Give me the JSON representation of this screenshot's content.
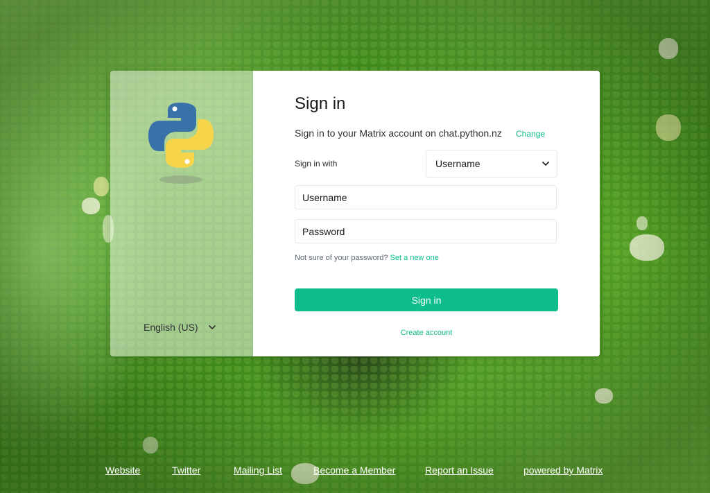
{
  "sidebar": {
    "language": "English (US)"
  },
  "auth": {
    "title": "Sign in",
    "subtitle": "Sign in to your Matrix account on chat.python.nz",
    "change_link": "Change",
    "sign_in_with_label": "Sign in with",
    "sign_in_method": "Username",
    "username_placeholder": "Username",
    "password_placeholder": "Password",
    "forgot_prefix": "Not sure of your password?",
    "forgot_link": "Set a new one",
    "submit_label": "Sign in",
    "create_account": "Create account"
  },
  "footer": {
    "links": [
      "Website",
      "Twitter",
      "Mailing List",
      "Become a Member",
      "Report an Issue",
      "powered by Matrix"
    ]
  },
  "colors": {
    "accent": "#0dbd8b",
    "python_blue": "#3872a8",
    "python_yellow": "#f7d54a"
  },
  "icons": {
    "logo": "python-logo",
    "dropdown": "chevron-down-icon"
  }
}
